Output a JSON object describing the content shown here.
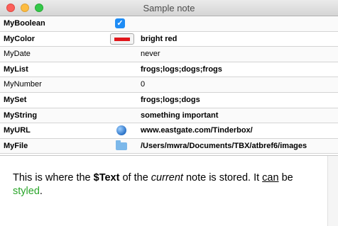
{
  "window": {
    "title": "Sample note"
  },
  "attributes": [
    {
      "name": "MyBoolean",
      "bold": true,
      "kind": "checkbox",
      "value": true,
      "display": "✓"
    },
    {
      "name": "MyColor",
      "bold": true,
      "kind": "color",
      "swatch": "#e0161b",
      "value": "bright red"
    },
    {
      "name": "MyDate",
      "bold": false,
      "kind": "text",
      "value": "never"
    },
    {
      "name": "MyList",
      "bold": true,
      "kind": "text",
      "value": "frogs;logs;dogs;frogs"
    },
    {
      "name": "MyNumber",
      "bold": false,
      "kind": "text",
      "value": "0"
    },
    {
      "name": "MySet",
      "bold": true,
      "kind": "text",
      "value": "frogs;logs;dogs"
    },
    {
      "name": "MyString",
      "bold": true,
      "kind": "text",
      "value": "something important"
    },
    {
      "name": "MyURL",
      "bold": true,
      "kind": "url",
      "icon": "globe-icon",
      "value": "www.eastgate.com/Tinderbox/"
    },
    {
      "name": "MyFile",
      "bold": true,
      "kind": "file",
      "icon": "folder-icon",
      "value": "/Users/mwra/Documents/TBX/atbref6/images"
    }
  ],
  "text": {
    "part1": "This is where the ",
    "bold": "$Text",
    "part2": " of the ",
    "italic": "current",
    "part3": " note is stored. It ",
    "underline": "can",
    "part4": " be ",
    "styled": "styled",
    "part5": "."
  },
  "colors": {
    "accent": "#1e8cf5",
    "styled_text": "#2aa52a"
  }
}
